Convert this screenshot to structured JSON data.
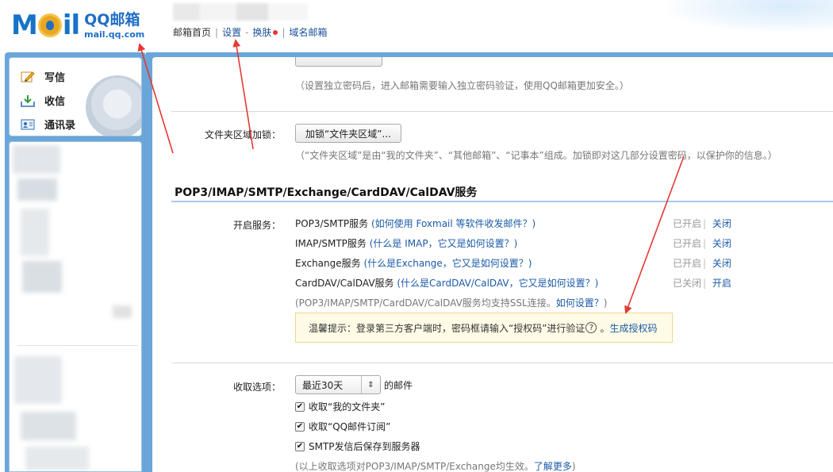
{
  "header": {
    "logo_cn": "QQ邮箱",
    "logo_url": "mail.qq.com",
    "nav": {
      "home": "邮箱首页",
      "settings": "设置",
      "dash": "-",
      "skin": "换肤",
      "domain_mail": "域名邮箱",
      "separator": "|"
    }
  },
  "sidebar": {
    "compose": "写信",
    "inbox": "收信",
    "contacts": "通讯录"
  },
  "main": {
    "pwd_note": "（设置独立密码后，进入邮箱需要输入独立密码验证，使用QQ邮箱更加安全。）",
    "folder_lock": {
      "label": "文件夹区域加锁：",
      "button": "加锁“文件夹区域”...",
      "note": "（“文件夹区域”是由“我的文件夹”、“其他邮箱”、“记事本”组成。加锁即对这几部分设置密码，以保护你的信息。）"
    },
    "section_title": "POP3/IMAP/SMTP/Exchange/CardDAV/CalDAV服务",
    "services_label": "开启服务：",
    "services": [
      {
        "name": "POP3/SMTP服务",
        "help": "(如何使用 Foxmail 等软件收发邮件？)",
        "status": "已开启",
        "action": "关闭"
      },
      {
        "name": "IMAP/SMTP服务",
        "help": "(什么是 IMAP，它又是如何设置？)",
        "status": "已开启",
        "action": "关闭"
      },
      {
        "name": "Exchange服务",
        "help": "(什么是Exchange，它又是如何设置？)",
        "status": "已开启",
        "action": "关闭"
      },
      {
        "name": "CardDAV/CalDAV服务",
        "help": "(什么是CardDAV/CalDAV，它又是如何设置？)",
        "status": "已关闭",
        "action": "开启"
      }
    ],
    "ssl_note": "(POP3/IMAP/SMTP/CardDAV/CalDAV服务均支持SSL连接。",
    "ssl_link": "如何设置？",
    "ssl_close": ")",
    "tip_text": "温馨提示：登录第三方客户端时，密码框请输入“授权码”进行验证",
    "tip_q": "?",
    "tip_dot": "。",
    "tip_link": "生成授权码",
    "receive_label": "收取选项：",
    "receive_select": "最近30天",
    "receive_select_arrow": "⇕",
    "receive_after": "的邮件",
    "checks": [
      {
        "label": "收取“我的文件夹”",
        "checked": true
      },
      {
        "label": "收取“QQ邮件订阅”",
        "checked": true
      },
      {
        "label": "SMTP发信后保存到服务器",
        "checked": true
      }
    ],
    "checkmark": "✔",
    "bottom_note": "(以上收取选项对POP3/IMAP/SMTP/Exchange均生效。",
    "bottom_link": "了解更多",
    "bottom_close": ")"
  }
}
